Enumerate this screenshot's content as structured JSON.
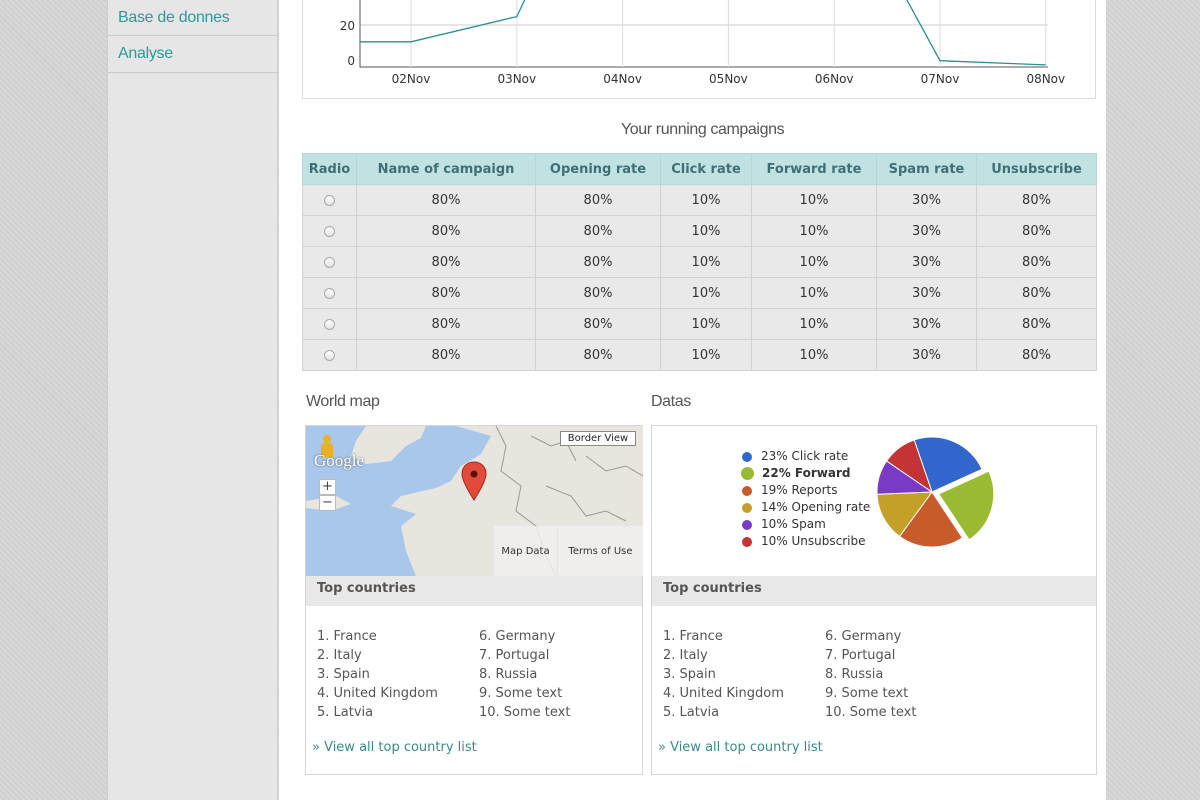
{
  "sidebar": {
    "items": [
      {
        "label": "Base de donnes"
      },
      {
        "label": "Analyse"
      }
    ]
  },
  "line_chart": {
    "chart_data": {
      "type": "line",
      "categories": [
        "02Nov",
        "03Nov",
        "04Nov",
        "05Nov",
        "06Nov",
        "07Nov",
        "08Nov"
      ],
      "y_ticks": [
        "0",
        "20"
      ],
      "points": [
        {
          "x": "01Nov",
          "y": 12
        },
        {
          "x": "02Nov",
          "y": 12
        },
        {
          "x": "03Nov",
          "y": 24
        },
        {
          "x": "03.15Nov",
          "y": 40
        },
        {
          "x": "06.6Nov",
          "y": 40
        },
        {
          "x": "07Nov",
          "y": 3
        },
        {
          "x": "08Nov",
          "y": 1
        }
      ],
      "ylim": [
        0,
        40
      ],
      "color": "#2b8f8f"
    }
  },
  "campaigns": {
    "title": "Your running campaigns",
    "columns": [
      "Radio",
      "Name of campaign",
      "Opening rate",
      "Click rate",
      "Forward rate",
      "Spam rate",
      "Unsubscribe"
    ],
    "rows": [
      [
        "80%",
        "80%",
        "10%",
        "10%",
        "30%",
        "80%"
      ],
      [
        "80%",
        "80%",
        "10%",
        "10%",
        "30%",
        "80%"
      ],
      [
        "80%",
        "80%",
        "10%",
        "10%",
        "30%",
        "80%"
      ],
      [
        "80%",
        "80%",
        "10%",
        "10%",
        "30%",
        "80%"
      ],
      [
        "80%",
        "80%",
        "10%",
        "10%",
        "30%",
        "80%"
      ],
      [
        "80%",
        "80%",
        "10%",
        "10%",
        "30%",
        "80%"
      ]
    ]
  },
  "world_map": {
    "title": "World map",
    "border_view": "Border View",
    "google_logo": "Google",
    "zoom_in": "+",
    "zoom_out": "−",
    "map_data": "Map Data",
    "terms": "Terms of Use",
    "top_countries_title": "Top countries",
    "countries_left": [
      "1. France",
      "2. Italy",
      "3. Spain",
      "4. United Kingdom",
      "5. Latvia"
    ],
    "countries_right": [
      "6. Germany",
      "7. Portugal",
      "8. Russia",
      "9. Some text",
      "10. Some text"
    ],
    "view_all": "» View all top country list"
  },
  "datas": {
    "title": "Datas",
    "top_countries_title": "Top countries",
    "countries_left": [
      "1. France",
      "2. Italy",
      "3. Spain",
      "4. United Kingdom",
      "5. Latvia"
    ],
    "countries_right": [
      "6. Germany",
      "7. Portugal",
      "8. Russia",
      "9. Some text",
      "10. Some text"
    ],
    "view_all": "» View all top country list",
    "chart_data": {
      "type": "pie",
      "slices": [
        {
          "label": "23% Click rate",
          "value": 23,
          "color": "#3366cc",
          "bold": false
        },
        {
          "label": "22% Forward",
          "value": 22,
          "color": "#99bb33",
          "bold": true,
          "exploded": true
        },
        {
          "label": "19% Reports",
          "value": 19,
          "color": "#c75b2a",
          "bold": false
        },
        {
          "label": "14% Opening rate",
          "value": 14,
          "color": "#c4a029",
          "bold": false
        },
        {
          "label": "10% Spam",
          "value": 10,
          "color": "#7b3ac6",
          "bold": false
        },
        {
          "label": "10% Unsubscribe",
          "value": 10,
          "color": "#c33434",
          "bold": false
        }
      ]
    }
  }
}
